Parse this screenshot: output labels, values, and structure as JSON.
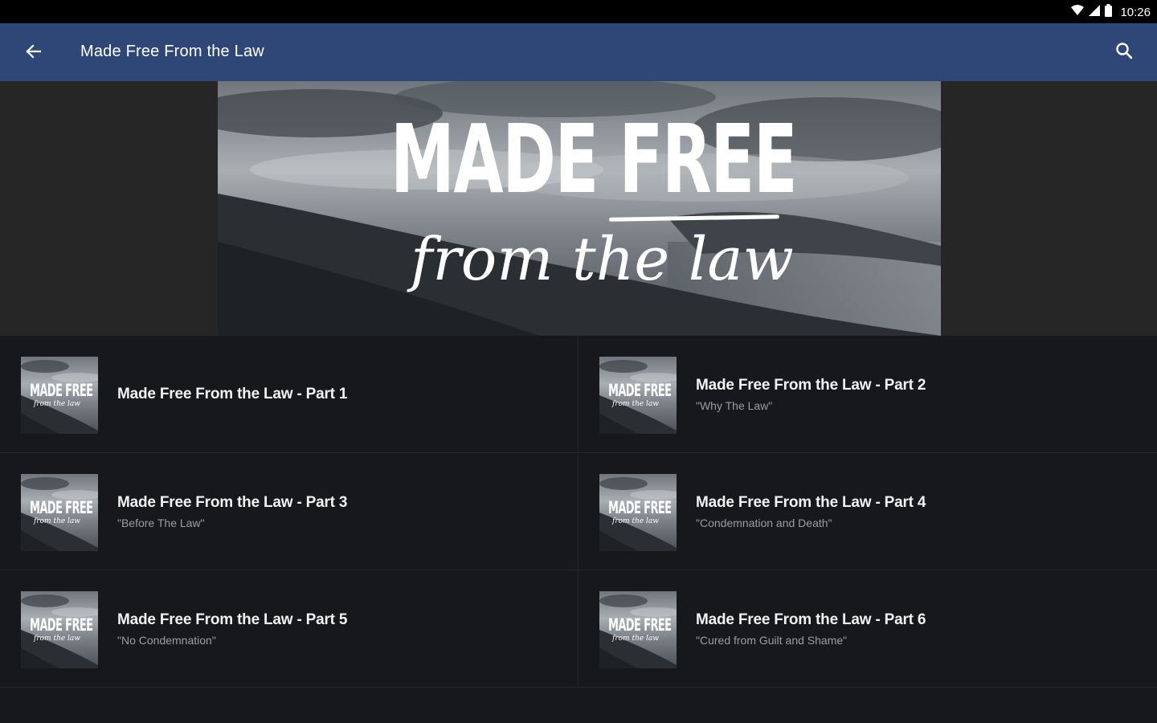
{
  "status_bar": {
    "time": "10:26"
  },
  "app_bar": {
    "title": "Made Free From the Law"
  },
  "hero": {
    "title_main": "MADE FREE",
    "title_script": "from the law"
  },
  "thumb_text": {
    "main": "MADE FREE",
    "script": "from the law"
  },
  "episodes": [
    {
      "title": "Made Free From the Law - Part 1",
      "subtitle": ""
    },
    {
      "title": "Made Free From the Law - Part 2",
      "subtitle": "\"Why The Law\""
    },
    {
      "title": "Made Free From the Law - Part 3",
      "subtitle": "\"Before The Law\""
    },
    {
      "title": "Made Free From the Law - Part 4",
      "subtitle": "\"Condemnation and Death\""
    },
    {
      "title": "Made Free From the Law - Part 5",
      "subtitle": "\"No Condemnation\""
    },
    {
      "title": "Made Free From the Law - Part 6",
      "subtitle": "\"Cured from Guilt and Shame\""
    }
  ],
  "colors": {
    "app_bar": "#2f4777",
    "status_bar": "#000000",
    "background": "#16181b",
    "hero_side": "#262626"
  },
  "icons": {
    "back": "arrow-back-icon",
    "search": "search-icon",
    "wifi": "wifi-icon",
    "signal": "signal-icon",
    "battery": "battery-icon"
  }
}
